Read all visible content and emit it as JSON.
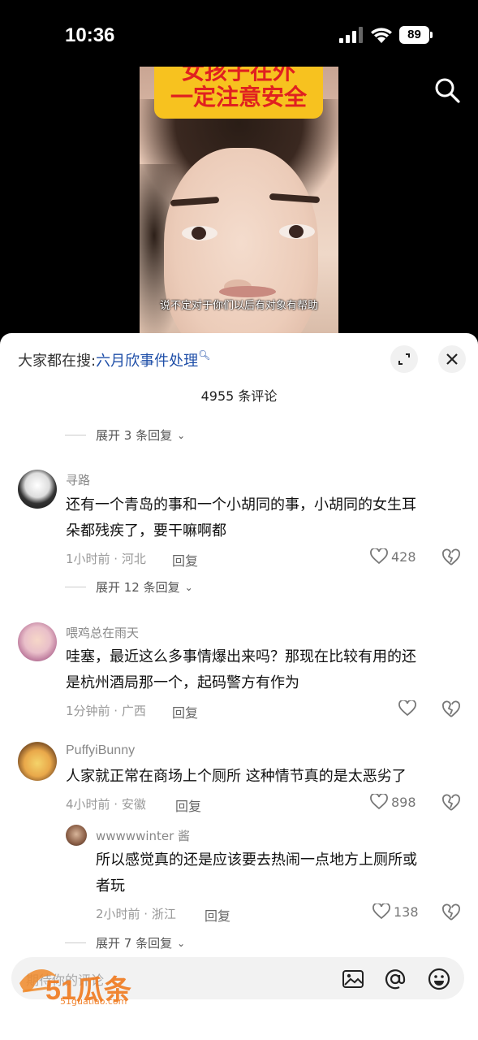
{
  "status_bar": {
    "time": "10:36",
    "battery": "89"
  },
  "video": {
    "banner_line1": "女孩子在外",
    "banner_line2": "一定注意安全",
    "subtitle": "说不定对于你们以后有对象有帮助"
  },
  "sheet": {
    "hot_prefix": "大家都在搜:",
    "hot_keyword": "六月欣事件处理",
    "comment_count": "4955 条评论",
    "input_placeholder": "期待你的评论"
  },
  "expand_top": "展开 3 条回复",
  "comments": [
    {
      "user": "寻路",
      "line1": "还有一个青岛的事和一个小胡同的事，小胡同的女生耳",
      "line2": "朵都残疾了，要干嘛啊都",
      "meta": "1小时前 · 河北",
      "reply": "回复",
      "likes": "428",
      "expand": "展开 12 条回复"
    },
    {
      "user": "喂鸡总在雨天",
      "line1": "哇塞，最近这么多事情爆出来吗？那现在比较有用的还",
      "line2": "是杭州酒局那一个，起码警方有作为",
      "meta": "1分钟前 · 广西",
      "reply": "回复",
      "likes": ""
    },
    {
      "user": "PuffyiBunny",
      "line1": "人家就正常在商场上个厕所 这种情节真的是太恶劣了",
      "meta": "4小时前 · 安徽",
      "reply": "回复",
      "likes": "898"
    }
  ],
  "sub_reply": {
    "user": "wwwwwinter 酱",
    "line1": "所以感觉真的还是应该要去热闹一点地方上厕所或",
    "line2": "者玩",
    "meta": "2小时前 · 浙江",
    "reply": "回复",
    "likes": "138"
  },
  "expand_bottom": "展开 7 条回复",
  "watermark": {
    "brand": "51瓜条",
    "url": "51guatiao.com"
  }
}
